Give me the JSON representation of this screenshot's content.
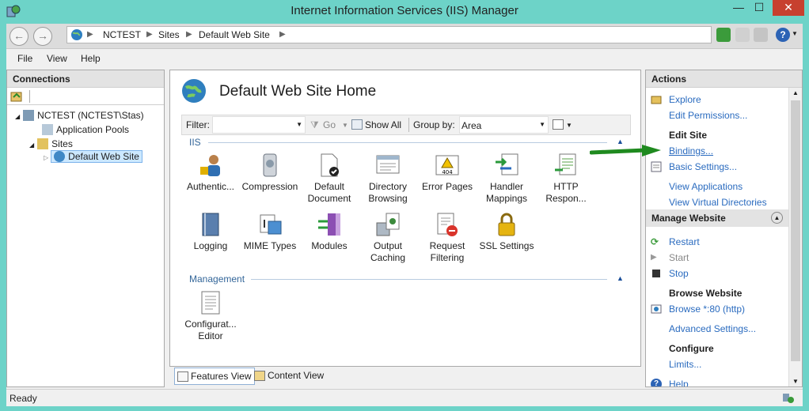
{
  "window": {
    "title": "Internet Information Services (IIS) Manager",
    "minimize": "—",
    "maximize": "☐",
    "close": "✕"
  },
  "address": {
    "crumbs": [
      "NCTEST",
      "Sites",
      "Default Web Site"
    ]
  },
  "menu": {
    "file": "File",
    "view": "View",
    "help": "Help"
  },
  "connections": {
    "title": "Connections",
    "tree": [
      {
        "label": "NCTEST (NCTEST\\Stas)"
      },
      {
        "label": "Application Pools"
      },
      {
        "label": "Sites"
      },
      {
        "label": "Default Web Site"
      }
    ]
  },
  "center": {
    "title": "Default Web Site Home",
    "filter_label": "Filter:",
    "go_label": "Go",
    "show_all_label": "Show All",
    "group_by_label": "Group by:",
    "group_by_value": "Area",
    "groups": {
      "iis": "IIS",
      "management": "Management"
    },
    "features": [
      {
        "line1": "Authentic...",
        "line2": ""
      },
      {
        "line1": "Compression",
        "line2": ""
      },
      {
        "line1": "Default",
        "line2": "Document"
      },
      {
        "line1": "Directory",
        "line2": "Browsing"
      },
      {
        "line1": "Error Pages",
        "line2": ""
      },
      {
        "line1": "Handler",
        "line2": "Mappings"
      },
      {
        "line1": "HTTP",
        "line2": "Respon..."
      },
      {
        "line1": "Logging",
        "line2": ""
      },
      {
        "line1": "MIME Types",
        "line2": ""
      },
      {
        "line1": "Modules",
        "line2": ""
      },
      {
        "line1": "Output",
        "line2": "Caching"
      },
      {
        "line1": "Request",
        "line2": "Filtering"
      },
      {
        "line1": "SSL Settings",
        "line2": ""
      },
      {
        "line1": "Configurat...",
        "line2": "Editor"
      }
    ]
  },
  "views": {
    "features": "Features View",
    "content": "Content View"
  },
  "actions": {
    "title": "Actions",
    "explore": "Explore",
    "edit_permissions": "Edit Permissions...",
    "edit_site": "Edit Site",
    "bindings": "Bindings...",
    "basic_settings": "Basic Settings...",
    "view_applications": "View Applications",
    "view_virtual_dirs": "View Virtual Directories",
    "manage_website": "Manage Website",
    "restart": "Restart",
    "start": "Start",
    "stop": "Stop",
    "browse_website": "Browse Website",
    "browse_80": "Browse *:80 (http)",
    "advanced_settings": "Advanced Settings...",
    "configure": "Configure",
    "limits": "Limits...",
    "help": "Help"
  },
  "status": {
    "text": "Ready"
  },
  "colors": {
    "link": "#2a6bbf",
    "window_frame": "#6dd3c8",
    "close_button": "#c7402f",
    "highlight_arrow": "#1f8a1f"
  }
}
